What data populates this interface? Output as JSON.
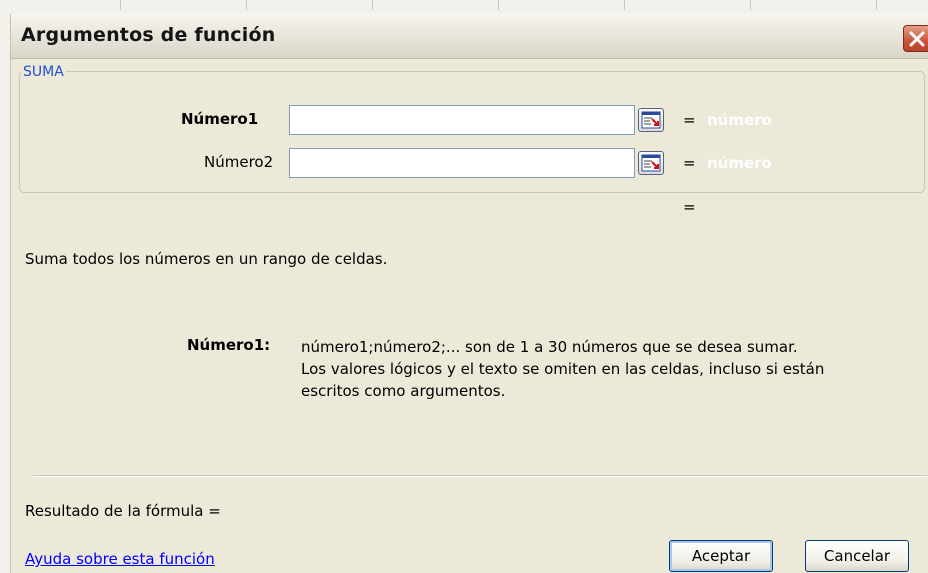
{
  "dialog": {
    "title": "Argumentos de función",
    "function_name": "SUMA"
  },
  "arguments": [
    {
      "label": "Número1",
      "value": "",
      "result_hint": "número",
      "equals": "="
    },
    {
      "label": "Número2",
      "value": "",
      "result_hint": "número",
      "equals": "="
    }
  ],
  "total_equals": "=",
  "description": "Suma todos los números en un rango de celdas.",
  "arg_help": {
    "label": "Número1:",
    "line1": "número1;número2;... son de 1 a 30 números que se desea sumar.",
    "line2": "Los valores lógicos y el texto se omiten en las celdas, incluso si están",
    "line3": "escritos como argumentos."
  },
  "result_label": "Resultado de la fórmula =",
  "help_link": "Ayuda sobre esta función",
  "buttons": {
    "ok": "Aceptar",
    "cancel": "Cancelar"
  },
  "colors": {
    "group_label": "#1f4fd6",
    "link": "#0000ff",
    "close_button": "#c8553b"
  }
}
